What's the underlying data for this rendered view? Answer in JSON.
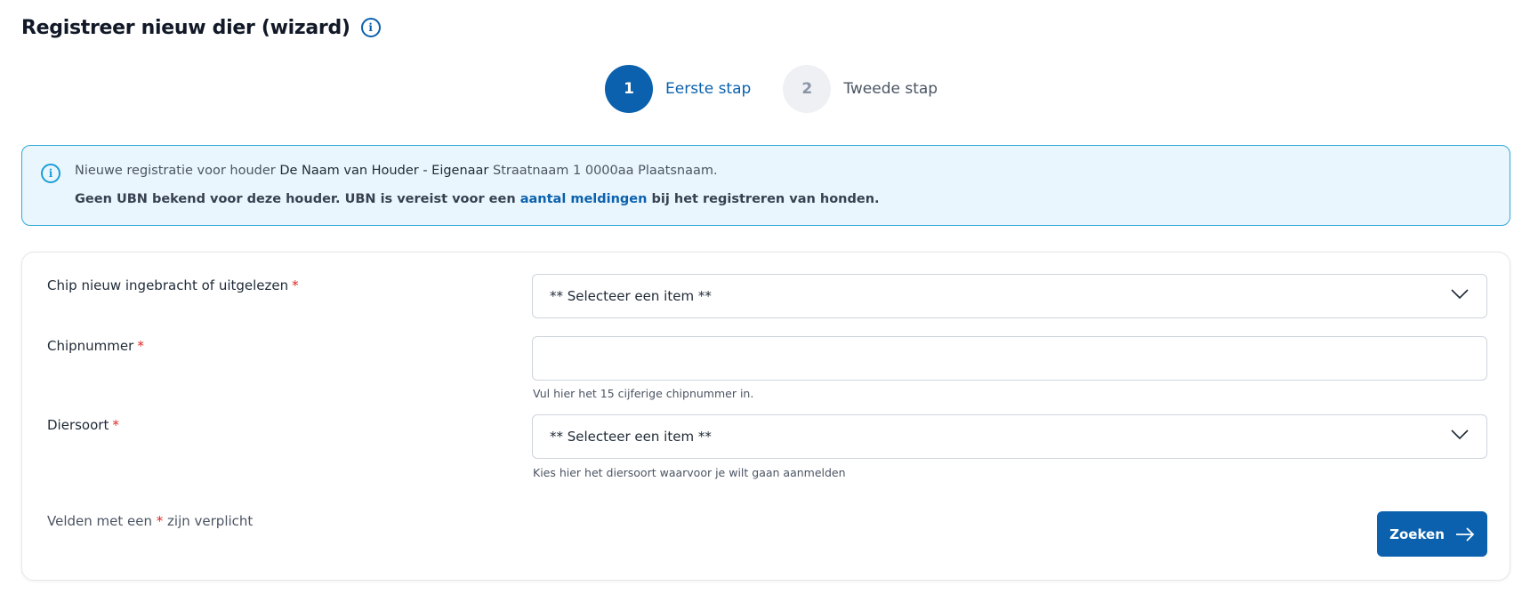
{
  "header": {
    "title": "Registreer nieuw dier (wizard)",
    "info_icon": "info-circle-icon"
  },
  "stepper": {
    "steps": [
      {
        "number": "1",
        "label": "Eerste stap",
        "state": "active"
      },
      {
        "number": "2",
        "label": "Tweede stap",
        "state": "inactive"
      }
    ]
  },
  "notice": {
    "icon": "info-circle-icon",
    "line1_prefix": "Nieuwe registratie voor houder",
    "holder_name": "De Naam van Houder - Eigenaar",
    "holder_address": "Straatnaam 1 0000aa Plaatsnaam.",
    "line2_prefix": "Geen UBN bekend voor deze houder. UBN is vereist voor een",
    "line2_link": "aantal meldingen",
    "line2_suffix": "bij het registreren van honden."
  },
  "form": {
    "chip_source": {
      "label": "Chip nieuw ingebracht of uitgelezen",
      "required_marker": "*",
      "selected_value": "** Selecteer een item **"
    },
    "chip_number": {
      "label": "Chipnummer",
      "required_marker": "*",
      "value": "",
      "help": "Vul hier het 15 cijferige chipnummer in."
    },
    "species": {
      "label": "Diersoort",
      "required_marker": "*",
      "selected_value": "** Selecteer een item **",
      "help": "Kies hier het diersoort waarvoor je wilt gaan aanmelden"
    },
    "required_note": {
      "prefix": "Velden met een",
      "star": "*",
      "suffix": "zijn verplicht"
    },
    "search_button": {
      "label": "Zoeken",
      "icon": "arrow-right-icon"
    }
  },
  "colors": {
    "primary": "#0b61ad",
    "info_bg": "#eaf6fd",
    "info_border": "#31a7d9",
    "required": "#e02424"
  }
}
